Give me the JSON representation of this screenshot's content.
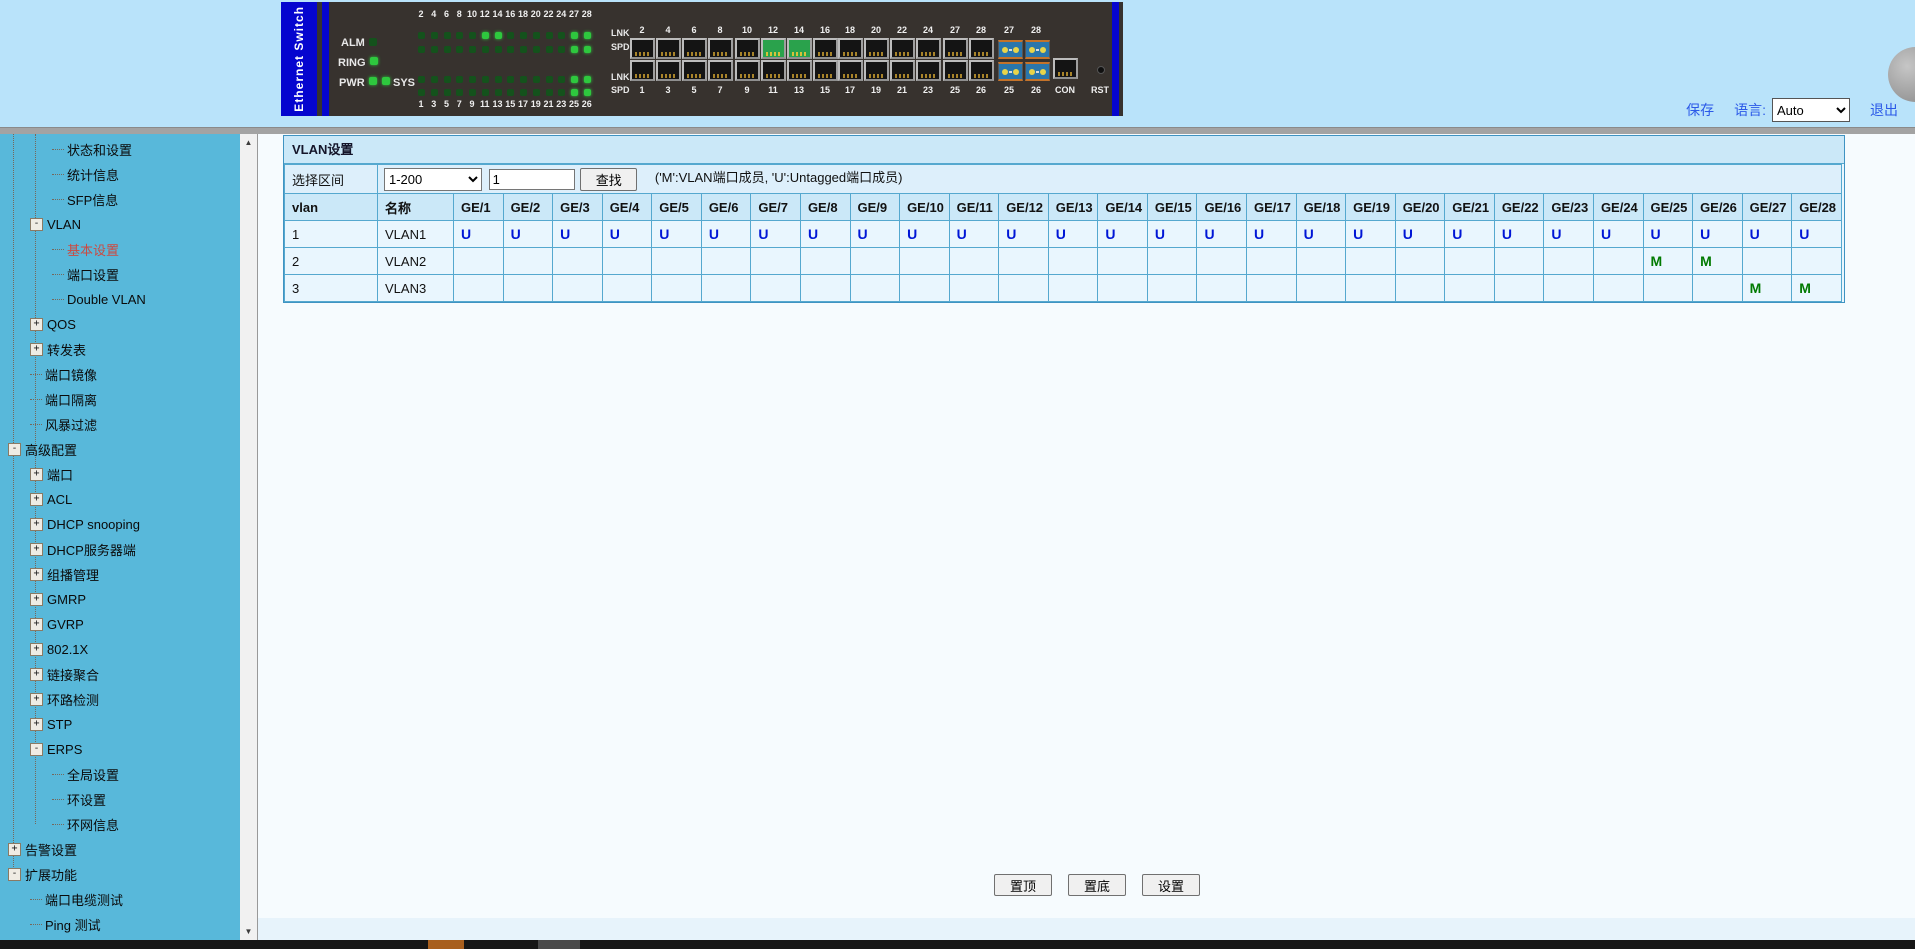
{
  "topbar": {
    "save": "保存",
    "language_label": "语言:",
    "language_value": "Auto",
    "logout": "退出"
  },
  "device": {
    "name": "Ethernet Switch",
    "labels": {
      "alm": "ALM",
      "ring": "RING",
      "pwr": "PWR",
      "sys": "SYS",
      "lnk": "LNK",
      "spd": "SPD",
      "con": "CON",
      "rst": "RST"
    },
    "led_cols_top": [
      "2",
      "4",
      "6",
      "8",
      "10",
      "12",
      "14",
      "16",
      "18",
      "20",
      "22",
      "24",
      "27",
      "28"
    ],
    "led_cols_bottom": [
      "1",
      "3",
      "5",
      "7",
      "9",
      "11",
      "13",
      "15",
      "17",
      "19",
      "21",
      "23",
      "25",
      "26"
    ],
    "led_bright_rows": [
      [
        5,
        6,
        12,
        13
      ],
      [
        12,
        13
      ],
      [
        12,
        13
      ],
      [
        12,
        13
      ]
    ],
    "port_groups": [
      {
        "top": [
          "2",
          "4",
          "6",
          "8"
        ],
        "bottom": [
          "1",
          "3",
          "5",
          "7"
        ]
      },
      {
        "top": [
          "10",
          "12",
          "14",
          "16"
        ],
        "bottom": [
          "9",
          "11",
          "13",
          "15"
        ]
      },
      {
        "top": [
          "18",
          "20",
          "22",
          "24"
        ],
        "bottom": [
          "17",
          "19",
          "21",
          "23"
        ]
      },
      {
        "top": [
          "27",
          "28"
        ],
        "bottom": [
          "25",
          "26"
        ]
      }
    ],
    "sfp_group": {
      "top": [
        "27",
        "28"
      ],
      "bottom": [
        "25",
        "26"
      ]
    },
    "lit_ports": [
      "12",
      "14"
    ]
  },
  "sidebar": {
    "items": [
      {
        "label": "状态和设置",
        "level": 3,
        "expand": null,
        "selected": false
      },
      {
        "label": "统计信息",
        "level": 3,
        "expand": null,
        "selected": false
      },
      {
        "label": "SFP信息",
        "level": 3,
        "expand": null,
        "selected": false
      },
      {
        "label": "VLAN",
        "level": 2,
        "expand": "-",
        "selected": false
      },
      {
        "label": "基本设置",
        "level": 3,
        "expand": null,
        "selected": true
      },
      {
        "label": "端口设置",
        "level": 3,
        "expand": null,
        "selected": false
      },
      {
        "label": "Double VLAN",
        "level": 3,
        "expand": null,
        "selected": false
      },
      {
        "label": "QOS",
        "level": 2,
        "expand": "+",
        "selected": false
      },
      {
        "label": "转发表",
        "level": 2,
        "expand": "+",
        "selected": false
      },
      {
        "label": "端口镜像",
        "level": 2,
        "expand": null,
        "selected": false
      },
      {
        "label": "端口隔离",
        "level": 2,
        "expand": null,
        "selected": false
      },
      {
        "label": "风暴过滤",
        "level": 2,
        "expand": null,
        "selected": false
      },
      {
        "label": "高级配置",
        "level": 1,
        "expand": "-",
        "selected": false
      },
      {
        "label": "端口",
        "level": 2,
        "expand": "+",
        "selected": false
      },
      {
        "label": "ACL",
        "level": 2,
        "expand": "+",
        "selected": false
      },
      {
        "label": "DHCP snooping",
        "level": 2,
        "expand": "+",
        "selected": false
      },
      {
        "label": "DHCP服务器端",
        "level": 2,
        "expand": "+",
        "selected": false
      },
      {
        "label": "组播管理",
        "level": 2,
        "expand": "+",
        "selected": false
      },
      {
        "label": "GMRP",
        "level": 2,
        "expand": "+",
        "selected": false
      },
      {
        "label": "GVRP",
        "level": 2,
        "expand": "+",
        "selected": false
      },
      {
        "label": "802.1X",
        "level": 2,
        "expand": "+",
        "selected": false
      },
      {
        "label": "链接聚合",
        "level": 2,
        "expand": "+",
        "selected": false
      },
      {
        "label": "环路检测",
        "level": 2,
        "expand": "+",
        "selected": false
      },
      {
        "label": "STP",
        "level": 2,
        "expand": "+",
        "selected": false
      },
      {
        "label": "ERPS",
        "level": 2,
        "expand": "-",
        "selected": false
      },
      {
        "label": "全局设置",
        "level": 3,
        "expand": null,
        "selected": false
      },
      {
        "label": "环设置",
        "level": 3,
        "expand": null,
        "selected": false
      },
      {
        "label": "环网信息",
        "level": 3,
        "expand": null,
        "selected": false
      },
      {
        "label": "告警设置",
        "level": 1,
        "expand": "+",
        "selected": false
      },
      {
        "label": "扩展功能",
        "level": 1,
        "expand": "-",
        "selected": false
      },
      {
        "label": "端口电缆测试",
        "level": 2,
        "expand": null,
        "selected": false
      },
      {
        "label": "Ping 测试",
        "level": 2,
        "expand": null,
        "selected": false
      }
    ]
  },
  "panel": {
    "title": "VLAN设置",
    "range_label": "选择区间",
    "range_value": "1-200",
    "search_value": "1",
    "search_button": "查找",
    "note": "('M':VLAN端口成员, 'U':Untagged端口成员)",
    "table": {
      "vlan_header": "vlan",
      "name_header": "名称",
      "port_headers": [
        "GE/1",
        "GE/2",
        "GE/3",
        "GE/4",
        "GE/5",
        "GE/6",
        "GE/7",
        "GE/8",
        "GE/9",
        "GE/10",
        "GE/11",
        "GE/12",
        "GE/13",
        "GE/14",
        "GE/15",
        "GE/16",
        "GE/17",
        "GE/18",
        "GE/19",
        "GE/20",
        "GE/21",
        "GE/22",
        "GE/23",
        "GE/24",
        "GE/25",
        "GE/26",
        "GE/27",
        "GE/28"
      ],
      "rows": [
        {
          "vlan": "1",
          "name": "VLAN1",
          "cells": [
            "U",
            "U",
            "U",
            "U",
            "U",
            "U",
            "U",
            "U",
            "U",
            "U",
            "U",
            "U",
            "U",
            "U",
            "U",
            "U",
            "U",
            "U",
            "U",
            "U",
            "U",
            "U",
            "U",
            "U",
            "U",
            "U",
            "U",
            "U"
          ]
        },
        {
          "vlan": "2",
          "name": "VLAN2",
          "cells": [
            "",
            "",
            "",
            "",
            "",
            "",
            "",
            "",
            "",
            "",
            "",
            "",
            "",
            "",
            "",
            "",
            "",
            "",
            "",
            "",
            "",
            "",
            "",
            "",
            "M",
            "M",
            "",
            ""
          ]
        },
        {
          "vlan": "3",
          "name": "VLAN3",
          "cells": [
            "",
            "",
            "",
            "",
            "",
            "",
            "",
            "",
            "",
            "",
            "",
            "",
            "",
            "",
            "",
            "",
            "",
            "",
            "",
            "",
            "",
            "",
            "",
            "",
            "",
            "",
            "M",
            "M"
          ]
        }
      ]
    },
    "buttons": [
      "置顶",
      "置底",
      "设置"
    ]
  }
}
